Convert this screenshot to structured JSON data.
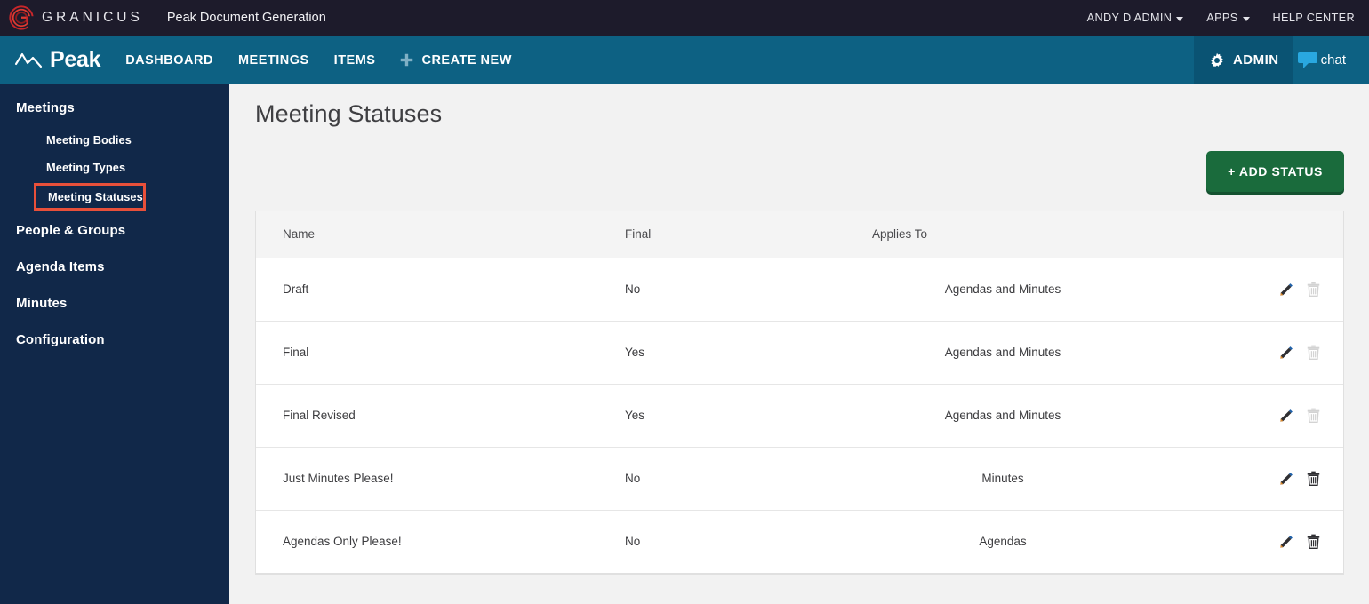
{
  "brandbar": {
    "logo_icon": "granicus-g-logo",
    "brand_word": "GRANICUS",
    "product_name": "Peak Document Generation",
    "right_items": [
      {
        "label": "ANDY D ADMIN",
        "has_caret": true
      },
      {
        "label": "APPS",
        "has_caret": true
      },
      {
        "label": "HELP CENTER",
        "has_caret": false
      }
    ]
  },
  "peaknav": {
    "logo_word": "Peak",
    "logo_icon": "peak-zigzag-icon",
    "links": [
      {
        "label": "DASHBOARD"
      },
      {
        "label": "MEETINGS"
      },
      {
        "label": "ITEMS"
      }
    ],
    "create_new": {
      "label": "CREATE NEW",
      "icon": "plus-icon"
    },
    "admin": {
      "label": "ADMIN",
      "icon": "gear-icon"
    },
    "chat": {
      "label": "chat",
      "icon": "speech-bubble-icon"
    }
  },
  "sidebar": {
    "items": [
      {
        "label": "Meetings",
        "level": "group"
      },
      {
        "label": "Meeting Bodies",
        "level": "sub"
      },
      {
        "label": "Meeting Types",
        "level": "sub"
      },
      {
        "label": "Meeting Statuses",
        "level": "sub",
        "highlighted": true
      },
      {
        "label": "People & Groups",
        "level": "group"
      },
      {
        "label": "Agenda Items",
        "level": "group"
      },
      {
        "label": "Minutes",
        "level": "group"
      },
      {
        "label": "Configuration",
        "level": "group"
      }
    ]
  },
  "main": {
    "page_title": "Meeting Statuses",
    "add_status_label": "+ ADD STATUS",
    "table": {
      "columns": [
        "Name",
        "Final",
        "Applies To"
      ],
      "rows": [
        {
          "name": "Draft",
          "final": "No",
          "applies_to": "Agendas and Minutes",
          "edit_icon": "pencil-icon",
          "delete_icon": "trash-icon",
          "delete_enabled": false
        },
        {
          "name": "Final",
          "final": "Yes",
          "applies_to": "Agendas and Minutes",
          "edit_icon": "pencil-icon",
          "delete_icon": "trash-icon",
          "delete_enabled": false
        },
        {
          "name": "Final Revised",
          "final": "Yes",
          "applies_to": "Agendas and Minutes",
          "edit_icon": "pencil-icon",
          "delete_icon": "trash-icon",
          "delete_enabled": false
        },
        {
          "name": "Just Minutes Please!",
          "final": "No",
          "applies_to": "Minutes",
          "edit_icon": "pencil-icon",
          "delete_icon": "trash-icon",
          "delete_enabled": true
        },
        {
          "name": "Agendas Only Please!",
          "final": "No",
          "applies_to": "Agendas",
          "edit_icon": "pencil-icon",
          "delete_icon": "trash-icon",
          "delete_enabled": true
        }
      ]
    }
  },
  "colors": {
    "brandbar_bg": "#1d1b2b",
    "peaknav_bg": "#0d6183",
    "admin_bg": "#0a5373",
    "sidebar_bg": "#112849",
    "highlight_outline": "#e8503a",
    "add_button_bg": "#1a6b3c",
    "page_bg": "#f2f2f2",
    "granicus_red": "#c9262a"
  }
}
